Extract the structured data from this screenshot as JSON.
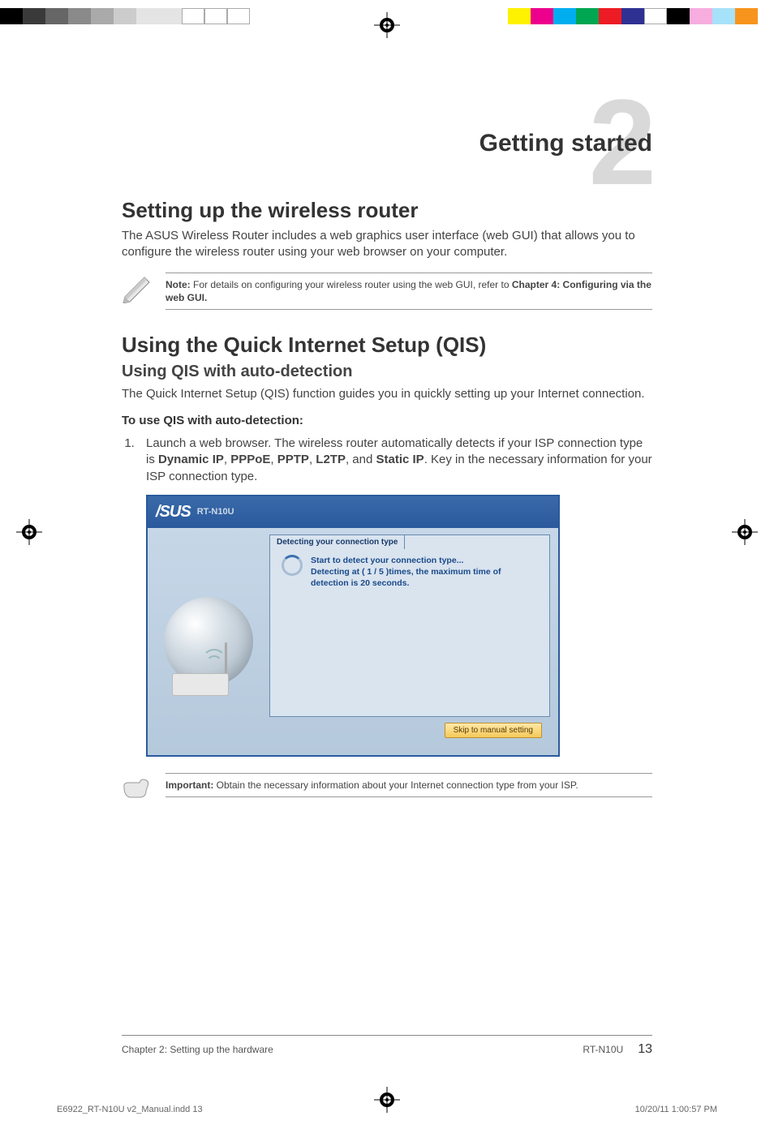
{
  "chapter": {
    "number": "2",
    "title": "Getting started"
  },
  "section1": {
    "heading": "Setting up the wireless router",
    "intro": "The ASUS Wireless Router includes a web graphics user interface (web GUI) that allows you to configure the wireless router using your web browser on your computer."
  },
  "note1": {
    "prefix": "Note:",
    "text": " For details on configuring your wireless router using the web GUI, refer to ",
    "bold_ref": "Chapter 4: Configuring via the web GUI."
  },
  "section2": {
    "heading": "Using the Quick Internet Setup (QIS)",
    "subheading": "Using QIS with auto-detection",
    "intro": "The Quick Internet Setup (QIS) function guides you in quickly setting up your Internet connection.",
    "lead": "To use QIS with auto-detection:",
    "step1_pre": "Launch a web browser. The wireless router automatically detects if your ISP connection type is ",
    "types": [
      "Dynamic IP",
      "PPPoE",
      "PPTP",
      "L2TP",
      "Static IP"
    ],
    "step1_post": ". Key in the necessary information for your ISP connection type."
  },
  "screenshot": {
    "logo": "/SUS",
    "model": "RT-N10U",
    "panel_title": "Detecting your connection type",
    "line1": "Start to detect your connection type...",
    "line2": "Detecting at ( 1 / 5 )times, the maximum time of",
    "line3": "detection is 20 seconds.",
    "skip_btn": "Skip to manual setting"
  },
  "important": {
    "prefix": "Important:",
    "text": "  Obtain the necessary information about your Internet connection type from your ISP."
  },
  "footer": {
    "left": "Chapter 2: Setting up the hardware",
    "mid": "RT-N10U",
    "page": "13"
  },
  "indd": {
    "file": "E6922_RT-N10U v2_Manual.indd   13",
    "date": "10/20/11   1:00:57 PM"
  }
}
